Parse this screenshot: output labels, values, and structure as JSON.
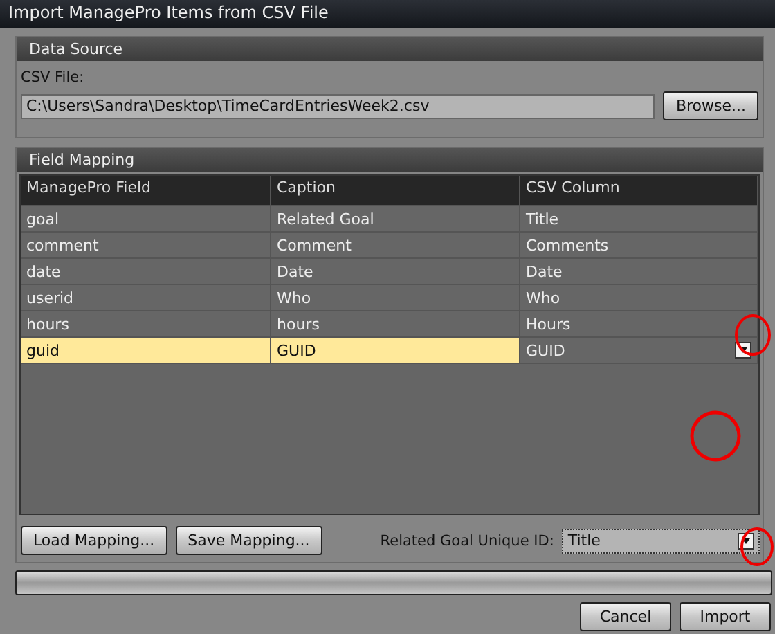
{
  "window": {
    "title": "Import ManagePro Items from CSV File"
  },
  "data_source": {
    "title": "Data Source",
    "csv_label": "CSV File:",
    "csv_value": "C:\\Users\\Sandra\\Desktop\\TimeCardEntriesWeek2.csv",
    "browse": "Browse..."
  },
  "field_mapping": {
    "title": "Field Mapping",
    "columns": [
      "ManagePro Field",
      "Caption",
      "CSV Column"
    ],
    "rows": [
      {
        "cells": [
          "goal",
          "Related Goal",
          "Title"
        ],
        "selected": false
      },
      {
        "cells": [
          "comment",
          "Comment",
          "Comments"
        ],
        "selected": false
      },
      {
        "cells": [
          "date",
          "Date",
          "Date"
        ],
        "selected": false
      },
      {
        "cells": [
          "userid",
          "Who",
          "Who"
        ],
        "selected": false
      },
      {
        "cells": [
          "hours",
          "hours",
          "Hours"
        ],
        "selected": false
      },
      {
        "cells": [
          "guid",
          "GUID",
          "GUID"
        ],
        "selected": true
      }
    ],
    "buttons": [
      "Load Mapping...",
      "Save Mapping..."
    ],
    "unique_id_label": "Related Goal Unique ID:",
    "unique_id_value": "Title"
  },
  "progress": {
    "level": 0
  },
  "buttons": [
    "Cancel",
    "Import"
  ]
}
